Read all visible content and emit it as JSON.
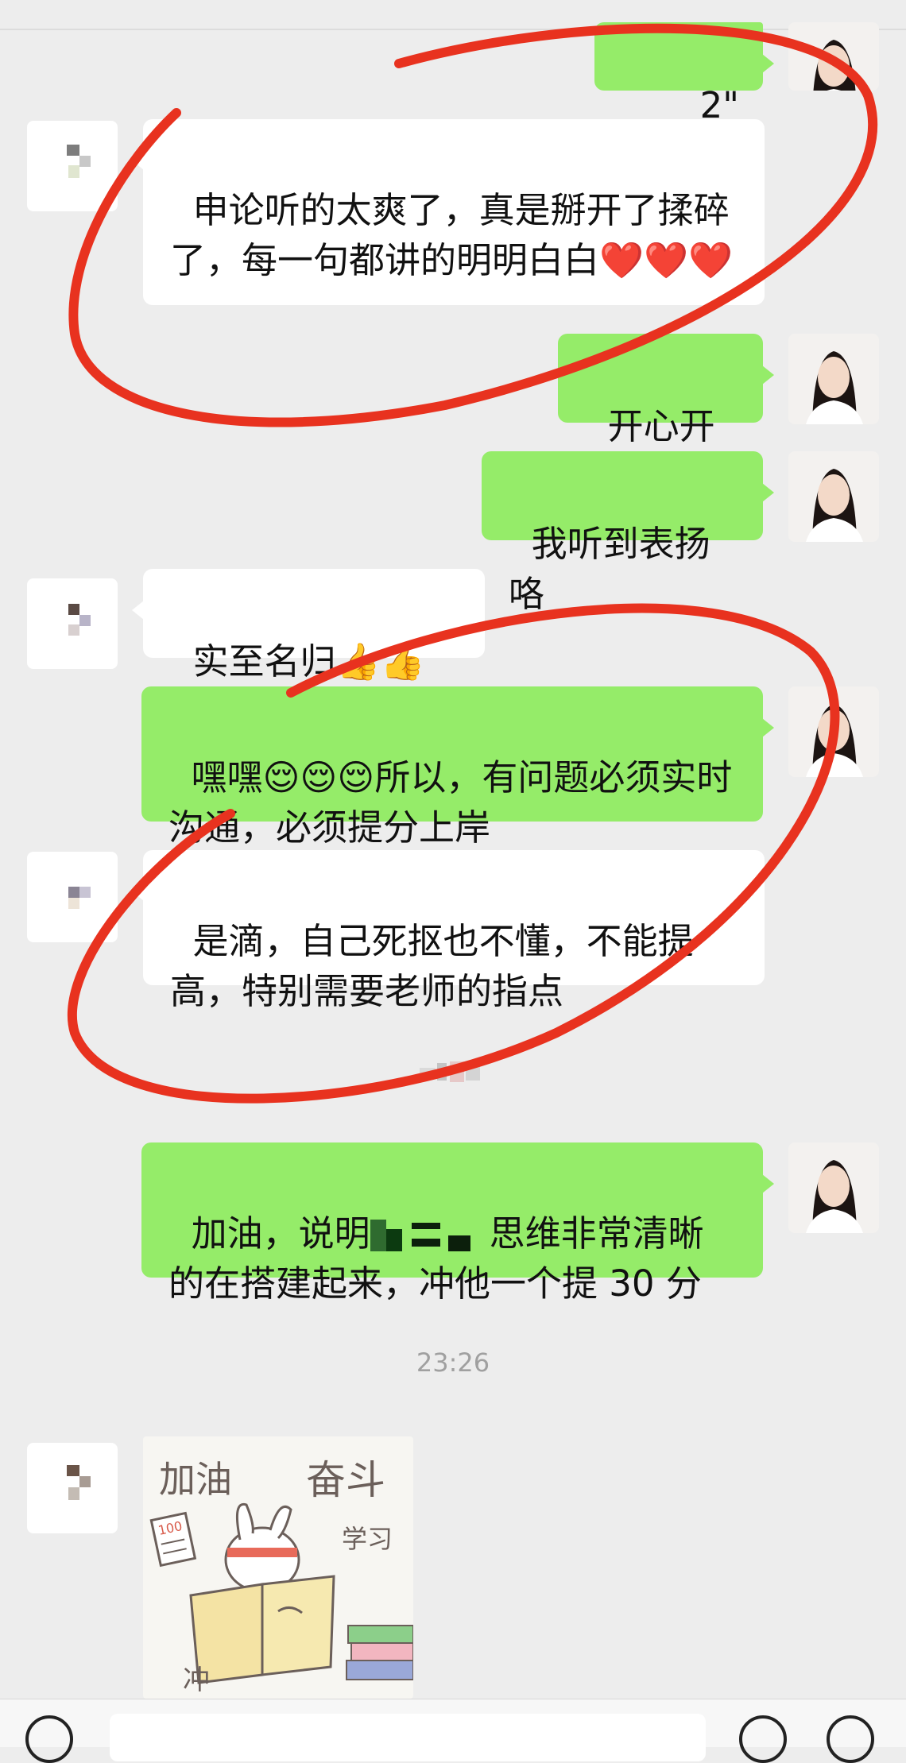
{
  "messages": {
    "voice_duration": "2\"",
    "m1": "申论听的太爽了，真是掰开了揉碎了，每一句都讲的明明白白❤️❤️❤️",
    "m2": "开心开心",
    "m3": "我听到表扬咯",
    "m4": "实至名归👍👍👍",
    "m5": "嘿嘿😌😌😌所以，有问题必须实时沟通，必须提分上岸",
    "m6": "是滴，自己死抠也不懂，不能提高，特别需要老师的指点",
    "m7_part1": "加油，说明",
    "m7_part2": "思维非常清晰的在搭建起来，冲他一个提 30 分"
  },
  "timestamp": "23:26",
  "sticker": {
    "text_jiayou": "加油",
    "text_fendou": "奋斗",
    "text_xuexi": "学习",
    "text_chong": "冲",
    "text_score": "100"
  },
  "colors": {
    "self_bubble": "#95ec69",
    "other_bubble": "#ffffff",
    "background": "#ededed",
    "annotation": "#e8321f"
  },
  "icons": [
    "voice-icon",
    "voice-input-icon",
    "emoji-icon",
    "plus-icon"
  ]
}
